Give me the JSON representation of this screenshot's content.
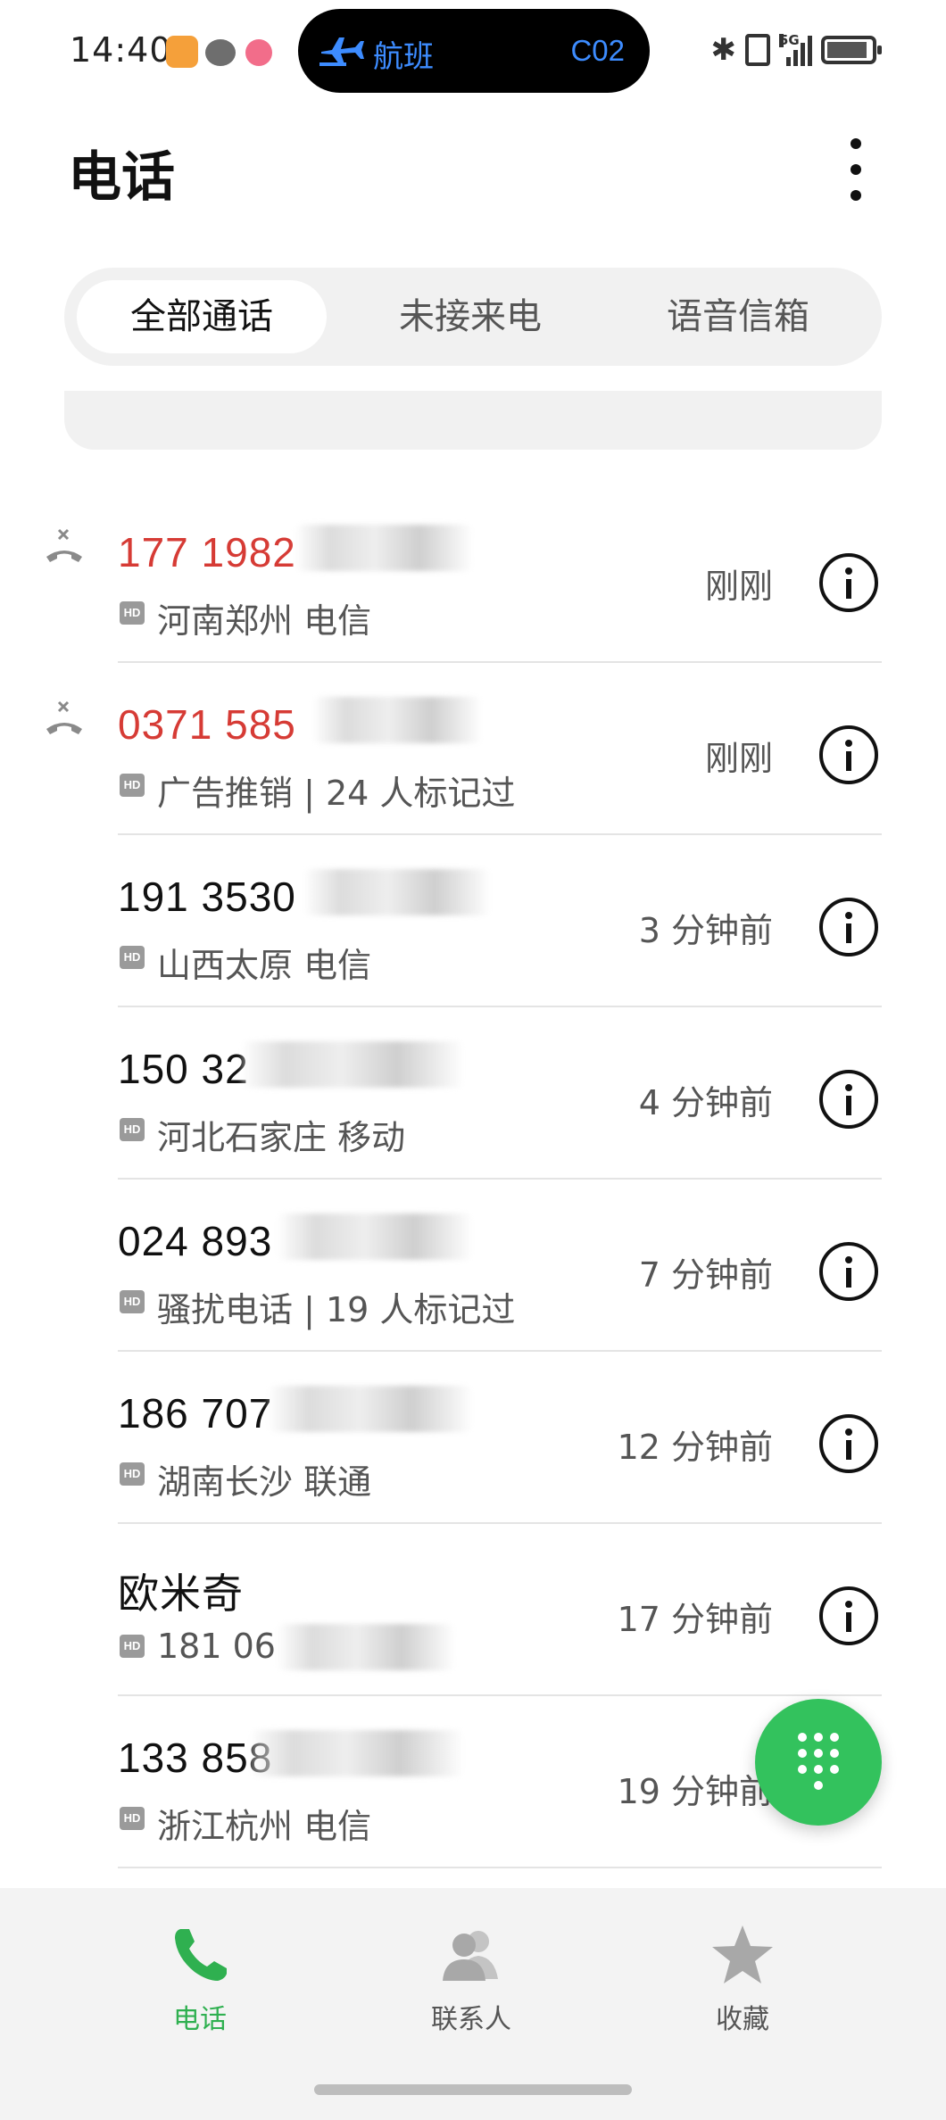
{
  "status_bar": {
    "time": "14:40",
    "pill": {
      "label": "航班",
      "gate": "C02"
    },
    "signal_label": "5G"
  },
  "header": {
    "title": "电话"
  },
  "tabs": [
    {
      "label": "全部通话",
      "selected": true
    },
    {
      "label": "未接来电",
      "selected": false
    },
    {
      "label": "语音信箱",
      "selected": false
    }
  ],
  "colors": {
    "accent_green": "#2fb050",
    "missed_red": "#d63b35",
    "fab_green": "#33c25d"
  },
  "calls": [
    {
      "number": "177 1982",
      "missed": true,
      "hd": "HD",
      "subtitle": "河南郑州 电信",
      "time": "刚刚"
    },
    {
      "number": "0371 585",
      "missed": true,
      "hd": "HD",
      "subtitle": "广告推销 | 24 人标记过",
      "time": "刚刚"
    },
    {
      "number": "191 3530",
      "missed": false,
      "hd": "HD",
      "subtitle": "山西太原 电信",
      "time": "3 分钟前"
    },
    {
      "number": "150 32",
      "missed": false,
      "hd": "HD",
      "subtitle": "河北石家庄 移动",
      "time": "4 分钟前"
    },
    {
      "number": "024 893",
      "missed": false,
      "hd": "HD",
      "subtitle": "骚扰电话 | 19 人标记过",
      "time": "7 分钟前"
    },
    {
      "number": "186 707",
      "missed": false,
      "hd": "HD",
      "subtitle": "湖南长沙 联通",
      "time": "12 分钟前"
    },
    {
      "number": "欧米奇",
      "missed": false,
      "hd": "HD",
      "subtitle": "181 06",
      "time": "17 分钟前"
    },
    {
      "number": "133 858",
      "missed": false,
      "hd": "HD",
      "subtitle": "浙江杭州 电信",
      "time": "19 分钟前"
    }
  ],
  "bottom_nav": [
    {
      "label": "电话",
      "icon": "phone-icon",
      "active": true
    },
    {
      "label": "联系人",
      "icon": "contacts-icon",
      "active": false
    },
    {
      "label": "收藏",
      "icon": "star-icon",
      "active": false
    }
  ]
}
